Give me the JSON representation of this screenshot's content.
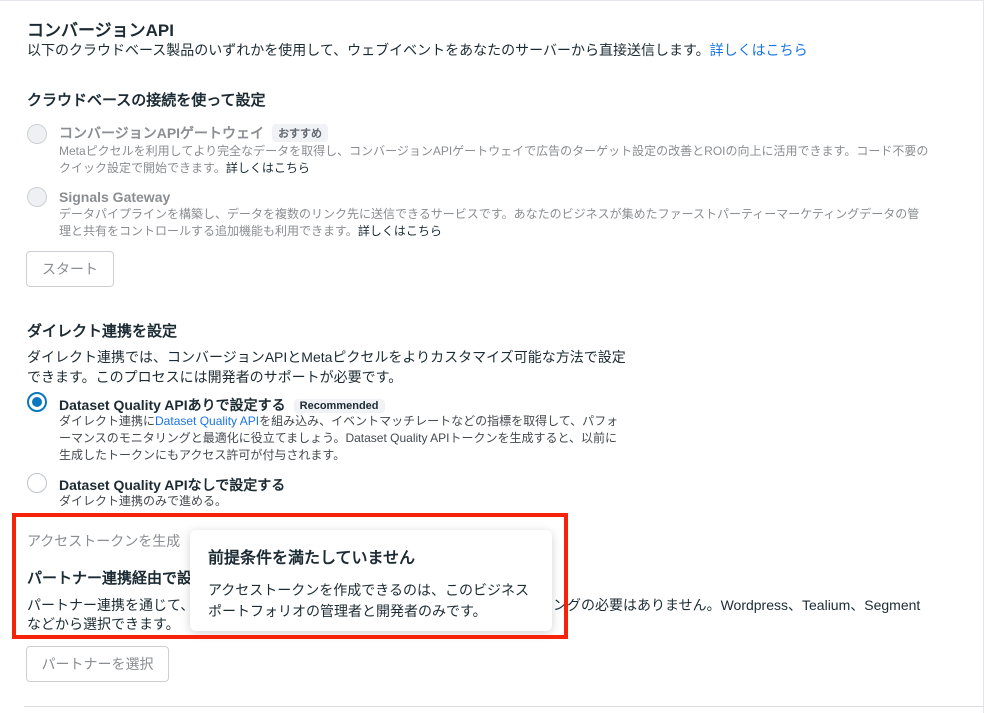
{
  "header": {
    "title": "コンバージョンAPI",
    "description": "以下のクラウドベース製品のいずれかを使用して、ウェブイベントをあなたのサーバーから直接送信します。",
    "learn_more": "詳しくはこちら"
  },
  "cloud": {
    "heading": "クラウドベースの接続を使って設定",
    "options": [
      {
        "title": "コンバージョンAPIゲートウェイ",
        "badge": "おすすめ",
        "desc_line1": "Metaピクセルを利用してより完全なデータを取得し、コンバージョンAPIゲートウェイで広告のターゲット設定の改善とROIの向上に活用できます。コード不要の",
        "desc_line2": "クイック設定で開始できます。",
        "link": "詳しくはこちら"
      },
      {
        "title": "Signals Gateway",
        "desc_line1": "データパイプラインを構築し、データを複数のリンク先に送信できるサービスです。あなたのビジネスが集めたファーストパーティーマーケティングデータの管",
        "desc_line2": "理と共有をコントロールする追加機能も利用できます。",
        "link": "詳しくはこちら"
      }
    ],
    "start_button": "スタート"
  },
  "direct": {
    "heading": "ダイレクト連携を設定",
    "desc_line1": "ダイレクト連携では、コンバージョンAPIとMetaピクセルをよりカスタマイズ可能な方法で設定",
    "desc_line2": "できます。このプロセスには開発者のサポートが必要です。",
    "options": [
      {
        "title": "Dataset Quality APIありで設定する",
        "badge": "Recommended",
        "desc_prefix": "ダイレクト連携に",
        "desc_link": "Dataset Quality API",
        "desc_suffix": "を組み込み、イベントマッチレートなどの指標を取得して、パフォ",
        "desc_line2": "ーマンスのモニタリングと最適化に役立てましょう。Dataset Quality APIトークンを生成すると、以前に",
        "desc_line3": "生成したトークンにもアクセス許可が付与されます。",
        "selected": true
      },
      {
        "title": "Dataset Quality APIなしで設定する",
        "desc": "ダイレクト連携のみで進める。",
        "selected": false
      }
    ],
    "token_button": "アクセストークンを生成"
  },
  "partner": {
    "heading": "パートナー連携経由で設",
    "desc_line1_start": "パートナー連携を通じて、",
    "desc_line1_end": "ングの必要はありません。Wordpress、Tealium、Segment",
    "desc_line2": "などから選択できます。",
    "select_button": "パートナーを選択"
  },
  "tooltip": {
    "title": "前提条件を満たしていません",
    "body_line1": "アクセストークンを作成できるのは、このビジネス",
    "body_line2": "ポートフォリオの管理者と開発者のみです。"
  },
  "colors": {
    "highlight_border": "#f5230a",
    "link": "#1b74e4",
    "radio_selected": "#0a78be"
  }
}
